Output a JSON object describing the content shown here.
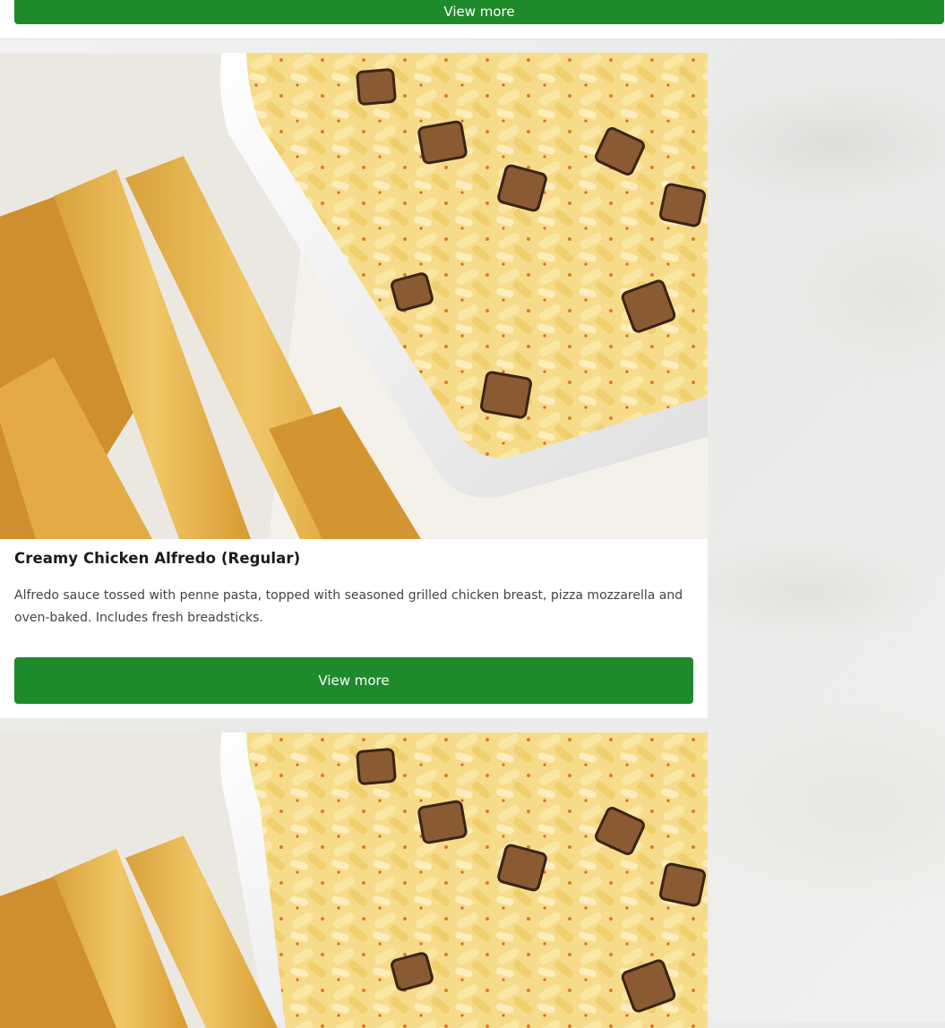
{
  "top_card": {
    "button_label": "View more"
  },
  "products": [
    {
      "name": "Creamy Chicken Alfredo (Regular)",
      "description": "Alfredo sauce tossed with penne pasta, topped with seasoned grilled chicken breast, pizza mozzarella and oven-baked. Includes fresh breadsticks.",
      "button_label": "View more"
    }
  ],
  "colors": {
    "button_green": "#1f8a2b",
    "button_text": "#ffffff",
    "title_text": "#1b1b1b",
    "body_text": "#444444",
    "page_background": "#eeeeec"
  }
}
